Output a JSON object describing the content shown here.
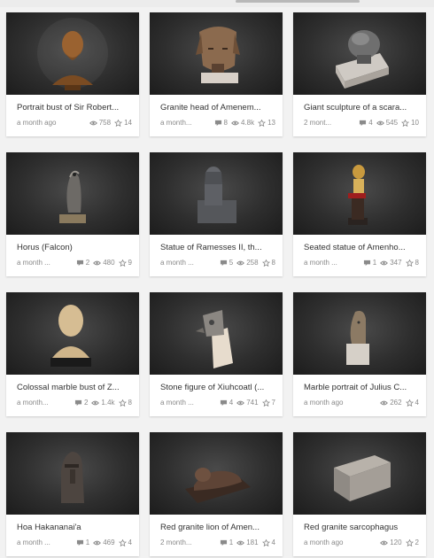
{
  "colors": {
    "icon": "#8a8a8a",
    "card_bg": "#ffffff",
    "thumb_bg": "#2e2e2e"
  },
  "cards": [
    {
      "title": "Portrait bust of Sir Robert...",
      "age": "a month ago",
      "comments": "",
      "views": "758",
      "likes": "14",
      "thumb_icon": "bronze-bust"
    },
    {
      "title": "Granite head of Amenem...",
      "age": "a month...",
      "comments": "8",
      "views": "4.8k",
      "likes": "13",
      "thumb_icon": "granite-head"
    },
    {
      "title": "Giant sculpture of a scara...",
      "age": "2 mont...",
      "comments": "4",
      "views": "545",
      "likes": "10",
      "thumb_icon": "scarab-sculpture"
    },
    {
      "title": "Horus (Falcon)",
      "age": "a month ...",
      "comments": "2",
      "views": "480",
      "likes": "9",
      "thumb_icon": "falcon-statue"
    },
    {
      "title": "Statue of Ramesses II, th...",
      "age": "a month ...",
      "comments": "5",
      "views": "258",
      "likes": "8",
      "thumb_icon": "seated-statue"
    },
    {
      "title": "Seated statue of Amenho...",
      "age": "a month ...",
      "comments": "1",
      "views": "347",
      "likes": "8",
      "thumb_icon": "pharaoh-statue"
    },
    {
      "title": "Colossal marble bust of Z...",
      "age": "a month...",
      "comments": "2",
      "views": "1.4k",
      "likes": "8",
      "thumb_icon": "marble-bust"
    },
    {
      "title": "Stone figure of Xiuhcoatl (...",
      "age": "a month ...",
      "comments": "4",
      "views": "741",
      "likes": "7",
      "thumb_icon": "serpent-figure"
    },
    {
      "title": "Marble portrait of Julius C...",
      "age": "a month ago",
      "comments": "",
      "views": "262",
      "likes": "4",
      "thumb_icon": "marble-head"
    },
    {
      "title": "Hoa Hakananai'a",
      "age": "a month ...",
      "comments": "1",
      "views": "469",
      "likes": "4",
      "thumb_icon": "moai-statue"
    },
    {
      "title": "Red granite lion of Amen...",
      "age": "2 month...",
      "comments": "1",
      "views": "181",
      "likes": "4",
      "thumb_icon": "lion-statue"
    },
    {
      "title": "Red granite sarcophagus",
      "age": "a month ago",
      "comments": "",
      "views": "120",
      "likes": "2",
      "thumb_icon": "sarcophagus"
    }
  ]
}
